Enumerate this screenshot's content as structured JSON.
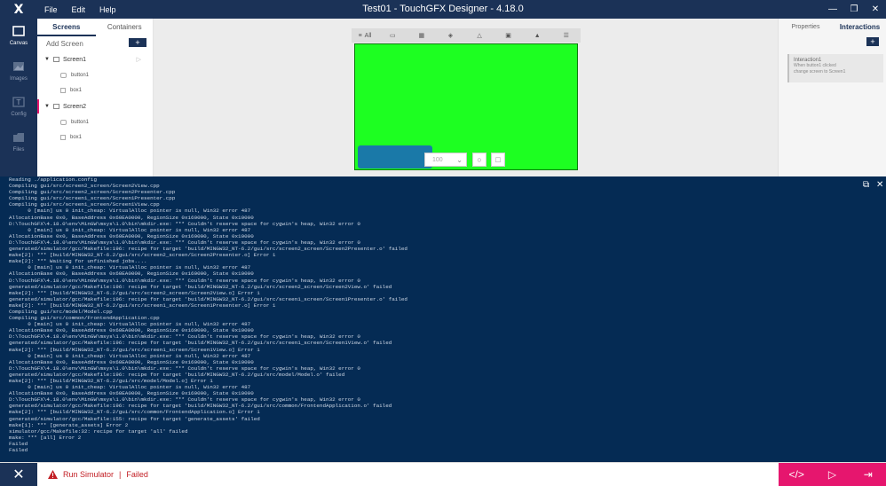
{
  "app": {
    "title": "Test01 - TouchGFX Designer - 4.18.0",
    "logo": "X",
    "menu": [
      "File",
      "Edit",
      "Help"
    ]
  },
  "rail": [
    {
      "label": "Canvas",
      "icon": "canvas-icon"
    },
    {
      "label": "Images",
      "icon": "images-icon"
    },
    {
      "label": "Config",
      "icon": "config-icon"
    },
    {
      "label": "Files",
      "icon": "files-icon"
    }
  ],
  "screens_panel": {
    "tabs": [
      "Screens",
      "Containers"
    ],
    "add_screen": "Add Screen",
    "add_symbol": "+",
    "tree": [
      {
        "name": "Screen1",
        "kind": "screen"
      },
      {
        "name": "button1",
        "kind": "widget"
      },
      {
        "name": "box1",
        "kind": "widget"
      },
      {
        "name": "Screen2",
        "kind": "screen"
      },
      {
        "name": "button1",
        "kind": "widget"
      },
      {
        "name": "box1",
        "kind": "widget"
      }
    ]
  },
  "canvas": {
    "toolbar_all": "All",
    "zoom": "100",
    "stage_color": "#1dff21",
    "button_color": "#1a79a8"
  },
  "properties_panel": {
    "tabs": [
      "Properties",
      "Interactions"
    ],
    "add_symbol": "+",
    "interaction": {
      "title": "Interaction1",
      "line1": "When button1 clicked",
      "line2": "change screen to Screen1"
    }
  },
  "console": {
    "lines": [
      "Reading ./application.config",
      "Compiling gui/src/screen2_screen/Screen2View.cpp",
      "Compiling gui/src/screen2_screen/Screen2Presenter.cpp",
      "Compiling gui/src/screen1_screen/Screen1Presenter.cpp",
      "Compiling gui/src/screen1_screen/Screen1View.cpp",
      "      0 [main] us 0 init_cheap: VirtualAlloc pointer is null, Win32 error 487",
      "AllocationBase 0x0, BaseAddress 0x60EA0000, RegionSize 0x160000, State 0x10000",
      "D:\\TouchGFX\\4.18.0\\env\\MinGW\\msys\\1.0\\bin\\mkdir.exe: *** Couldn't reserve space for cygwin's heap, Win32 error 0",
      "      0 [main] us 0 init_cheap: VirtualAlloc pointer is null, Win32 error 487",
      "AllocationBase 0x0, BaseAddress 0x60EA0000, RegionSize 0x160000, State 0x10000",
      "D:\\TouchGFX\\4.18.0\\env\\MinGW\\msys\\1.0\\bin\\mkdir.exe: *** Couldn't reserve space for cygwin's heap, Win32 error 0",
      "generated/simulator/gcc/Makefile:196: recipe for target 'build/MINGW32_NT-6.2/gui/src/screen2_screen/Screen2Presenter.o' failed",
      "make[2]: *** [build/MINGW32_NT-6.2/gui/src/screen2_screen/Screen2Presenter.o] Error 1",
      "make[2]: *** Waiting for unfinished jobs....",
      "      0 [main] us 0 init_cheap: VirtualAlloc pointer is null, Win32 error 487",
      "AllocationBase 0x0, BaseAddress 0x60EA0000, RegionSize 0x160000, State 0x10000",
      "D:\\TouchGFX\\4.18.0\\env\\MinGW\\msys\\1.0\\bin\\mkdir.exe: *** Couldn't reserve space for cygwin's heap, Win32 error 0",
      "generated/simulator/gcc/Makefile:196: recipe for target 'build/MINGW32_NT-6.2/gui/src/screen2_screen/Screen2View.o' failed",
      "make[2]: *** [build/MINGW32_NT-6.2/gui/src/screen2_screen/Screen2View.o] Error 1",
      "generated/simulator/gcc/Makefile:196: recipe for target 'build/MINGW32_NT-6.2/gui/src/screen1_screen/Screen1Presenter.o' failed",
      "make[2]: *** [build/MINGW32_NT-6.2/gui/src/screen1_screen/Screen1Presenter.o] Error 1",
      "Compiling gui/src/model/Model.cpp",
      "Compiling gui/src/common/FrontendApplication.cpp",
      "      0 [main] us 0 init_cheap: VirtualAlloc pointer is null, Win32 error 487",
      "AllocationBase 0x0, BaseAddress 0x60EA0000, RegionSize 0x160000, State 0x10000",
      "D:\\TouchGFX\\4.18.0\\env\\MinGW\\msys\\1.0\\bin\\mkdir.exe: *** Couldn't reserve space for cygwin's heap, Win32 error 0",
      "generated/simulator/gcc/Makefile:196: recipe for target 'build/MINGW32_NT-6.2/gui/src/screen1_screen/Screen1View.o' failed",
      "make[2]: *** [build/MINGW32_NT-6.2/gui/src/screen1_screen/Screen1View.o] Error 1",
      "      0 [main] us 0 init_cheap: VirtualAlloc pointer is null, Win32 error 487",
      "AllocationBase 0x0, BaseAddress 0x60EA0000, RegionSize 0x160000, State 0x10000",
      "D:\\TouchGFX\\4.18.0\\env\\MinGW\\msys\\1.0\\bin\\mkdir.exe: *** Couldn't reserve space for cygwin's heap, Win32 error 0",
      "generated/simulator/gcc/Makefile:196: recipe for target 'build/MINGW32_NT-6.2/gui/src/model/Model.o' failed",
      "make[2]: *** [build/MINGW32_NT-6.2/gui/src/model/Model.o] Error 1",
      "      0 [main] us 0 init_cheap: VirtualAlloc pointer is null, Win32 error 487",
      "AllocationBase 0x0, BaseAddress 0x60EA0000, RegionSize 0x160000, State 0x10000",
      "D:\\TouchGFX\\4.18.0\\env\\MinGW\\msys\\1.0\\bin\\mkdir.exe: *** Couldn't reserve space for cygwin's heap, Win32 error 0",
      "generated/simulator/gcc/Makefile:196: recipe for target 'build/MINGW32_NT-6.2/gui/src/common/FrontendApplication.o' failed",
      "make[2]: *** [build/MINGW32_NT-6.2/gui/src/common/FrontendApplication.o] Error 1",
      "generated/simulator/gcc/Makefile:155: recipe for target 'generate_assets' failed",
      "make[1]: *** [generate_assets] Error 2",
      "simulator/gcc/Makefile:32: recipe for target 'all' failed",
      "make: *** [all] Error 2",
      "Failed",
      "Failed"
    ]
  },
  "statusbar": {
    "task": "Run Simulator",
    "separator": "|",
    "result": "Failed",
    "status_color": "#c21e24",
    "accent": "#e6166e"
  }
}
